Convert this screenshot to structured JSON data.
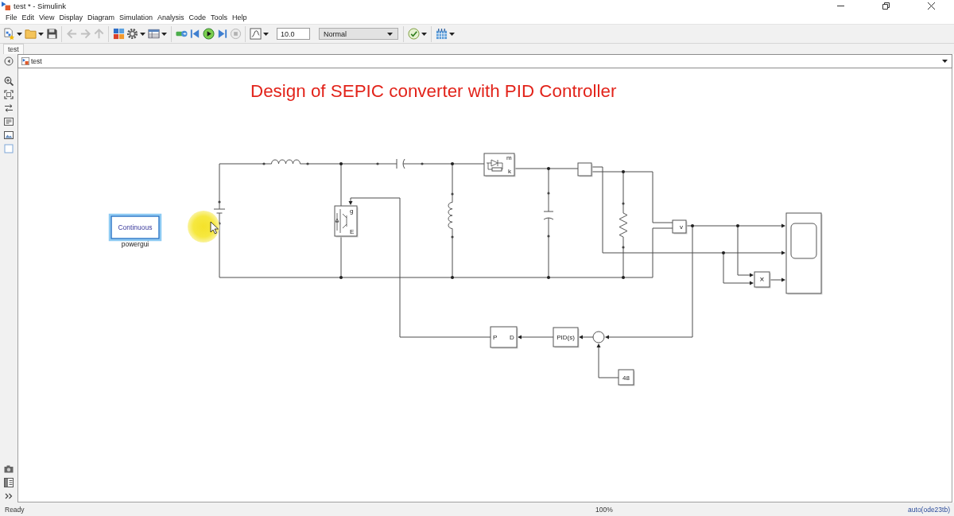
{
  "window": {
    "title": "test * - Simulink"
  },
  "menu_bar": [
    "File",
    "Edit",
    "View",
    "Display",
    "Diagram",
    "Simulation",
    "Analysis",
    "Code",
    "Tools",
    "Help"
  ],
  "toolbar": {
    "groups": [
      [
        {
          "kind": "new",
          "dropdown": true,
          "disabled": false
        },
        {
          "kind": "open",
          "dropdown": true,
          "disabled": false
        },
        {
          "kind": "save",
          "dropdown": false,
          "disabled": false
        }
      ],
      [
        {
          "kind": "back",
          "dropdown": false,
          "disabled": true
        },
        {
          "kind": "forward",
          "dropdown": false,
          "disabled": true
        },
        {
          "kind": "up",
          "dropdown": false,
          "disabled": true
        }
      ],
      [
        {
          "kind": "library",
          "dropdown": false,
          "disabled": false
        },
        {
          "kind": "settings",
          "dropdown": true,
          "disabled": false
        },
        {
          "kind": "explorer",
          "dropdown": true,
          "disabled": false
        }
      ],
      [
        {
          "kind": "inspector",
          "dropdown": false,
          "disabled": false
        },
        {
          "kind": "stepback",
          "dropdown": false,
          "disabled": false
        },
        {
          "kind": "run",
          "dropdown": false,
          "disabled": false
        },
        {
          "kind": "stepforward",
          "dropdown": false,
          "disabled": false
        },
        {
          "kind": "stop",
          "dropdown": false,
          "disabled": true
        }
      ],
      [
        {
          "kind": "scope",
          "dropdown": true,
          "disabled": false
        },
        {
          "kind": "field",
          "value": "10.0",
          "dropdown": false,
          "disabled": false
        },
        {
          "kind": "select",
          "value": "Normal",
          "dropdown": true,
          "disabled": false
        }
      ],
      [
        {
          "kind": "check",
          "dropdown": true,
          "disabled": false
        }
      ],
      [
        {
          "kind": "build",
          "dropdown": true,
          "disabled": false
        }
      ]
    ]
  },
  "tabs": [
    {
      "label": "test",
      "selected": true
    }
  ],
  "breadcrumb": {
    "label": "test"
  },
  "diagram": {
    "annotation": "Design of SEPIC converter with PID Controller",
    "blocks": [
      {
        "kind": "powergui",
        "selected": true,
        "label": "Continuous",
        "caption": "powergui"
      },
      {
        "kind": "source",
        "selected": false
      },
      {
        "kind": "inductor",
        "selected": false
      },
      {
        "kind": "switch",
        "selected": false,
        "ports": [
          "g",
          "E"
        ]
      },
      {
        "kind": "capacitor",
        "selected": false
      },
      {
        "kind": "inductor",
        "selected": false
      },
      {
        "kind": "diode",
        "selected": false,
        "ports": [
          "m",
          "k"
        ]
      },
      {
        "kind": "capacitor",
        "selected": false
      },
      {
        "kind": "ammeter",
        "selected": false
      },
      {
        "kind": "resistor",
        "selected": false
      },
      {
        "kind": "voltmeter",
        "selected": false,
        "label": "v"
      },
      {
        "kind": "scope",
        "selected": false
      },
      {
        "kind": "product",
        "selected": false,
        "label": "×"
      },
      {
        "kind": "pwm",
        "selected": false,
        "ports": [
          "P",
          "D"
        ]
      },
      {
        "kind": "pid",
        "selected": false,
        "label": "PID(s)"
      },
      {
        "kind": "sum",
        "selected": false
      },
      {
        "kind": "constant",
        "selected": false,
        "label": "48"
      }
    ]
  },
  "status_bar": {
    "status": "Ready",
    "zoom": "100%",
    "solver": "auto(ode23tb)"
  }
}
